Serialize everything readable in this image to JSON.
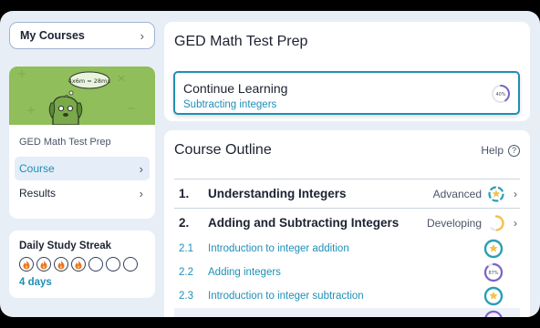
{
  "sidebar": {
    "my_courses_label": "My Courses",
    "course_name": "GED Math Test Prep",
    "image_text": "4x6m = 28mx",
    "nav_items": [
      {
        "label": "Course",
        "active": true
      },
      {
        "label": "Results",
        "active": false
      }
    ],
    "streak": {
      "title": "Daily Study Streak",
      "days_label": "4 days",
      "days_filled": 4,
      "days_total": 7
    }
  },
  "header": {
    "page_title": "GED Math Test Prep",
    "continue": {
      "title": "Continue Learning",
      "lesson": "Subtracting integers",
      "progress_label": "40%",
      "progress": 0.4
    }
  },
  "outline": {
    "title": "Course Outline",
    "help_label": "Help",
    "help_icon": "?",
    "units": [
      {
        "num": "1.",
        "title": "Understanding Integers",
        "level": "Advanced"
      },
      {
        "num": "2.",
        "title": "Adding and Subtracting Integers",
        "level": "Developing"
      }
    ],
    "lessons": [
      {
        "num": "2.1",
        "title": "Introduction to integer addition",
        "status": "star"
      },
      {
        "num": "2.2",
        "title": "Adding integers",
        "status": "progress",
        "progress_label": "87%",
        "progress": 0.87
      },
      {
        "num": "2.3",
        "title": "Introduction to integer subtraction",
        "status": "star"
      }
    ]
  },
  "colors": {
    "accent": "#1f8fb6",
    "star": "#f2c14b",
    "mastery": "#2a9fb3",
    "progress": "#7b62c9"
  }
}
